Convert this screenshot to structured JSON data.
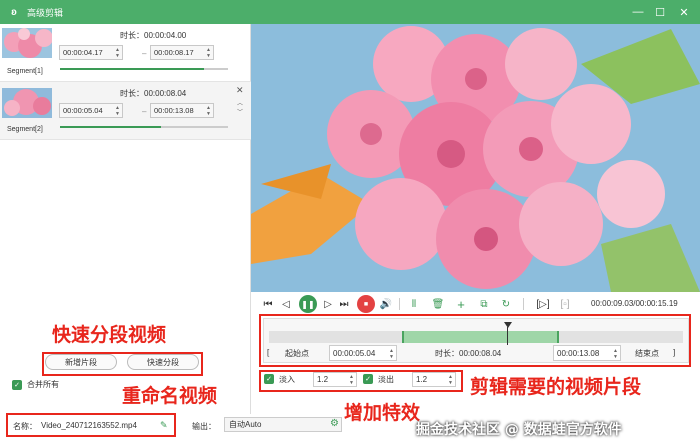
{
  "titlebar": {
    "title": "高级剪辑",
    "minimize": "—",
    "maximize": "☐",
    "close": "✕"
  },
  "segments": [
    {
      "name": "Segment[1]",
      "duration_label": "时长：00:00:04.00",
      "start": "00:00:04.17",
      "end": "00:00:08.17",
      "bar_fill": 0.86
    },
    {
      "name": "Segment[2]",
      "duration_label": "时长：00:00:08.04",
      "start": "00:00:05.04",
      "end": "00:00:13.08",
      "bar_fill": 0.6
    }
  ],
  "actions": {
    "new_segment": "新增片段",
    "quick_split": "快速分段"
  },
  "merge_all": "合并所有",
  "file": {
    "name_label": "名称：",
    "name_value": "Video_240712163552.mp4",
    "output_label": "输出：",
    "output_value": "自动Auto"
  },
  "playback": {
    "time_readout": "00:00:09.03/00:00:15.19"
  },
  "range": {
    "start_btn": "起始点",
    "start_value": "00:00:05.04",
    "duration_label": "时长：00:00:08.04",
    "end_value": "00:00:13.08",
    "end_btn": "结束点"
  },
  "effects": {
    "fade_in_label": "淡入",
    "fade_in_value": "1.2",
    "fade_out_label": "淡出",
    "fade_out_value": "1.2"
  },
  "annotations": {
    "quick_split": "快速分段视频",
    "rename": "重命名视频",
    "clip": "剪辑需要的视频片段",
    "effects": "增加特效"
  },
  "watermark": "掘金技术社区 @ 数据蛙官方软件",
  "colors": {
    "brand": "#4cae6a",
    "accent": "#3a9a55",
    "annotation": "#e8261c"
  }
}
